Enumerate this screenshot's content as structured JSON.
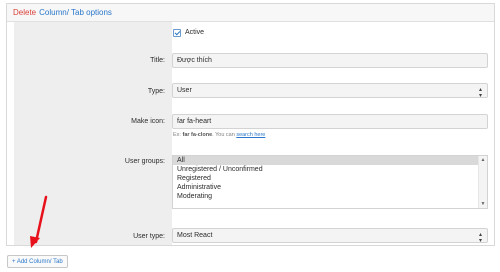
{
  "header": {
    "delete_label": "Delete",
    "options_label": "Column/ Tab options"
  },
  "active": {
    "label": "Active",
    "checked": true
  },
  "fields": {
    "title_label": "Title:",
    "title_value": "Được thích",
    "type_label": "Type:",
    "type_value": "User",
    "icon_label": "Make icon:",
    "icon_value": "far fa-heart",
    "icon_hint_prefix": "Ex:",
    "icon_hint_example": "far fa-clone",
    "icon_hint_middle": ". You can",
    "icon_hint_link": "search here",
    "groups_label": "User groups:",
    "user_type_label": "User type:",
    "user_type_value": "Most React"
  },
  "user_groups": [
    {
      "label": "All",
      "selected": true
    },
    {
      "label": "Unregistered / Unconfirmed",
      "selected": false
    },
    {
      "label": "Registered",
      "selected": false
    },
    {
      "label": "Administrative",
      "selected": false
    },
    {
      "label": "Moderating",
      "selected": false
    }
  ],
  "add_button": {
    "label": "+ Add Column/ Tab"
  },
  "colors": {
    "accent": "#2a77c9",
    "danger": "#d9413a",
    "arrow": "#e8101a"
  }
}
